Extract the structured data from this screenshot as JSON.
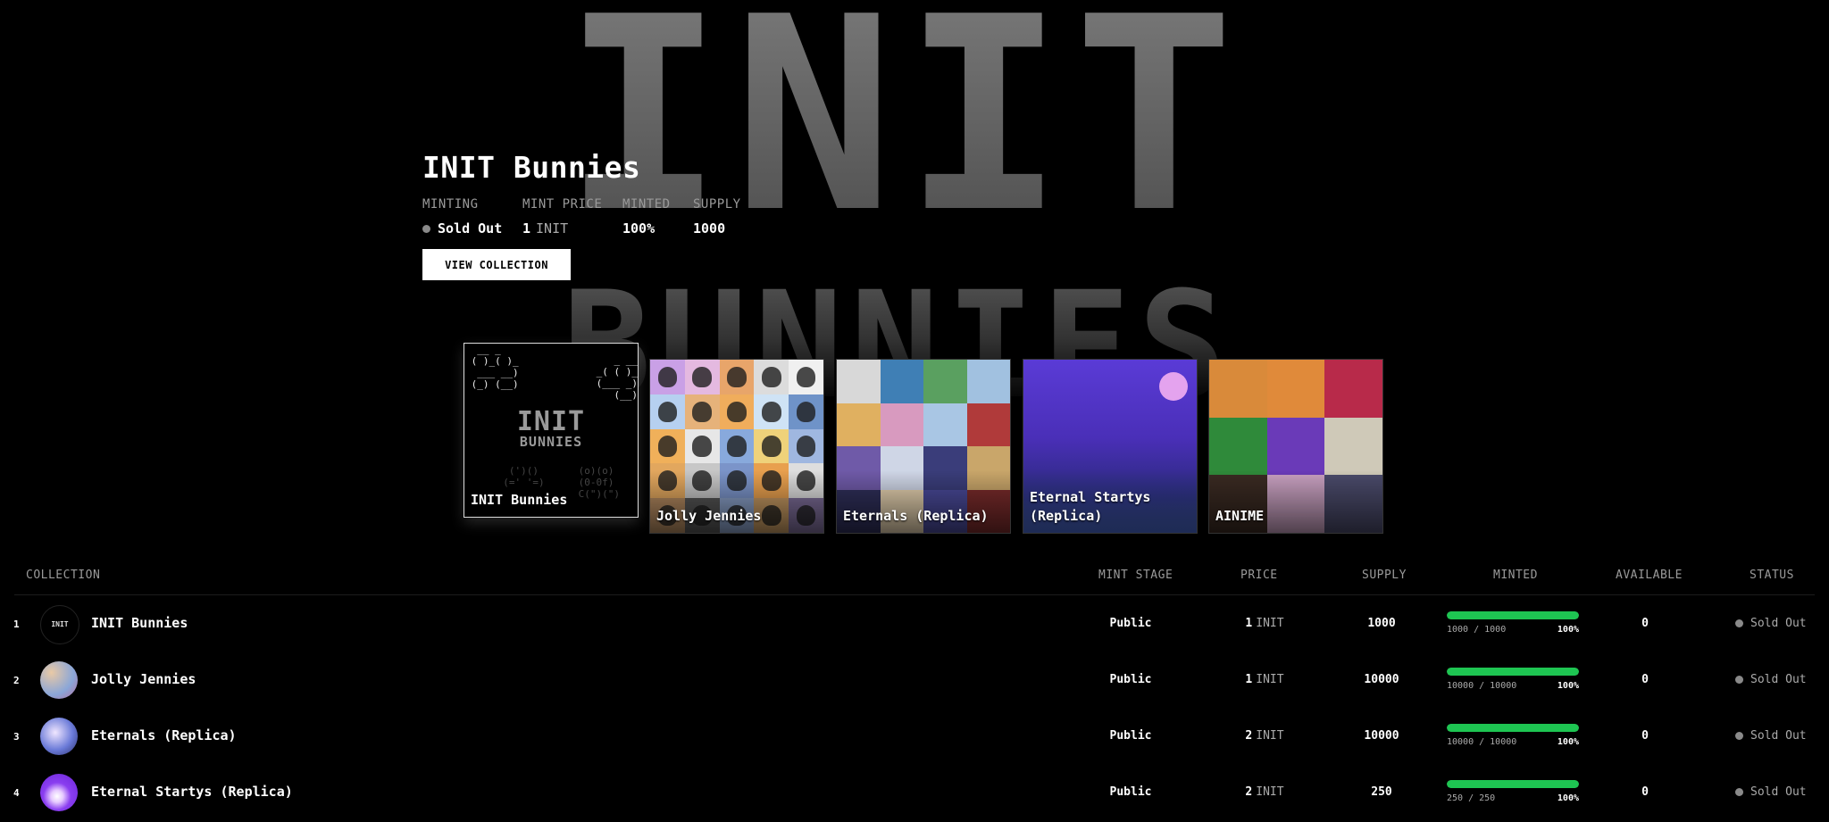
{
  "background": {
    "word_top": "INIT",
    "word_bottom": "BUNNIES"
  },
  "hero": {
    "title": "INIT Bunnies",
    "stats": [
      {
        "label": "MINTING",
        "value": "Sold Out"
      },
      {
        "label": "MINT PRICE",
        "value": "1",
        "unit": "INIT"
      },
      {
        "label": "MINTED",
        "value": "100%"
      },
      {
        "label": "SUPPLY",
        "value": "1000"
      }
    ],
    "button_label": "VIEW COLLECTION"
  },
  "cards": [
    {
      "label": "INIT Bunnies",
      "logo_a": "INIT",
      "logo_b": "BUNNIES",
      "ascii_left": "  __ _\n ( )_( )_\n  ___ __)\n (_) (__)",
      "ascii_right": "  _ __\n_( ( )_\n(___ _)\n  (__)",
      "ascii_bl": "   (')()\n  (=' '=)",
      "ascii_br": " (o)(o)\n (0-0f)\n C(\")(\")"
    },
    {
      "label": "Jolly Jennies"
    },
    {
      "label": "Eternals (Replica)"
    },
    {
      "label": "Eternal Startys (Replica)"
    },
    {
      "label": "AINIME"
    }
  ],
  "table": {
    "headers": {
      "collection": "COLLECTION",
      "mint_stage": "MINT STAGE",
      "price": "PRICE",
      "supply": "SUPPLY",
      "minted": "MINTED",
      "available": "AVAILABLE",
      "status": "STATUS"
    },
    "rows": [
      {
        "rank": "1",
        "name": "INIT Bunnies",
        "stage": "Public",
        "price": "1",
        "price_unit": "INIT",
        "supply": "1000",
        "minted_fraction": "1000 / 1000",
        "minted_pct": "100%",
        "progress": 1.0,
        "available": "0",
        "status": "Sold Out"
      },
      {
        "rank": "2",
        "name": "Jolly Jennies",
        "stage": "Public",
        "price": "1",
        "price_unit": "INIT",
        "supply": "10000",
        "minted_fraction": "10000 / 10000",
        "minted_pct": "100%",
        "progress": 1.0,
        "available": "0",
        "status": "Sold Out"
      },
      {
        "rank": "3",
        "name": "Eternals (Replica)",
        "stage": "Public",
        "price": "2",
        "price_unit": "INIT",
        "supply": "10000",
        "minted_fraction": "10000 / 10000",
        "minted_pct": "100%",
        "progress": 1.0,
        "available": "0",
        "status": "Sold Out"
      },
      {
        "rank": "4",
        "name": "Eternal Startys (Replica)",
        "stage": "Public",
        "price": "2",
        "price_unit": "INIT",
        "supply": "250",
        "minted_fraction": "250 / 250",
        "minted_pct": "100%",
        "progress": 1.0,
        "available": "0",
        "status": "Sold Out"
      }
    ]
  },
  "colors": {
    "accent_green": "#1ec552",
    "status_dot": "#8a8a8a"
  }
}
